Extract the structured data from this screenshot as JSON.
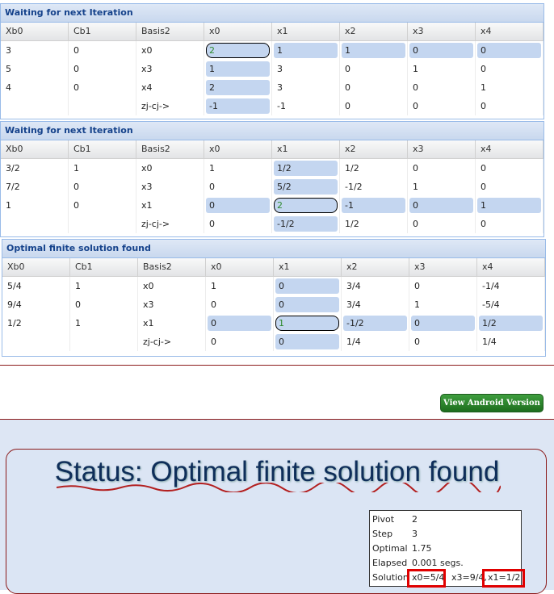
{
  "columns": [
    "Xb0",
    "Cb1",
    "Basis2",
    "x0",
    "x1",
    "x2",
    "x3",
    "x4"
  ],
  "panels": [
    {
      "title": "Waiting for next Iteration",
      "rows": [
        [
          "3",
          "0",
          "x0",
          "2",
          "1",
          "1",
          "0",
          "0"
        ],
        [
          "5",
          "0",
          "x3",
          "1",
          "3",
          "0",
          "1",
          "0"
        ],
        [
          "4",
          "0",
          "x4",
          "2",
          "3",
          "0",
          "0",
          "1"
        ],
        [
          "",
          "",
          "zj-cj->",
          "-1",
          "-1",
          "0",
          "0",
          "0"
        ]
      ]
    },
    {
      "title": "Waiting for next Iteration",
      "rows": [
        [
          "3/2",
          "1",
          "x0",
          "1",
          "1/2",
          "1/2",
          "0",
          "0"
        ],
        [
          "7/2",
          "0",
          "x3",
          "0",
          "5/2",
          "-1/2",
          "1",
          "0"
        ],
        [
          "1",
          "0",
          "x1",
          "0",
          "2",
          "-1",
          "0",
          "1"
        ],
        [
          "",
          "",
          "zj-cj->",
          "0",
          "-1/2",
          "1/2",
          "0",
          "0"
        ]
      ]
    },
    {
      "title": "Optimal finite solution found",
      "rows": [
        [
          "5/4",
          "1",
          "x0",
          "1",
          "0",
          "3/4",
          "0",
          "-1/4"
        ],
        [
          "9/4",
          "0",
          "x3",
          "0",
          "0",
          "3/4",
          "1",
          "-5/4"
        ],
        [
          "1/2",
          "1",
          "x1",
          "0",
          "1",
          "-1/2",
          "0",
          "1/2"
        ],
        [
          "",
          "",
          "zj-cj->",
          "0",
          "0",
          "1/4",
          "0",
          "1/4"
        ]
      ]
    }
  ],
  "android_button": "View Android Version",
  "status_title": "Status: Optimal finite solution found",
  "info": {
    "pivot_label": "Pivot",
    "pivot": "2",
    "step_label": "Step",
    "step": "3",
    "optimal_label": "Optimal",
    "optimal": "1.75",
    "elapsed_label": "Elapsed",
    "elapsed": "0.001 segs.",
    "solution_label": "Solution",
    "sol_x0": "x0=5/4",
    "sol_x3": "x3=9/4,",
    "sol_x1": "x1=1/2"
  },
  "colors": {
    "highlight": "#c4d6f0",
    "header_text": "#15428b",
    "accent_red": "#e00000",
    "button_green": "#2a7f2a"
  }
}
